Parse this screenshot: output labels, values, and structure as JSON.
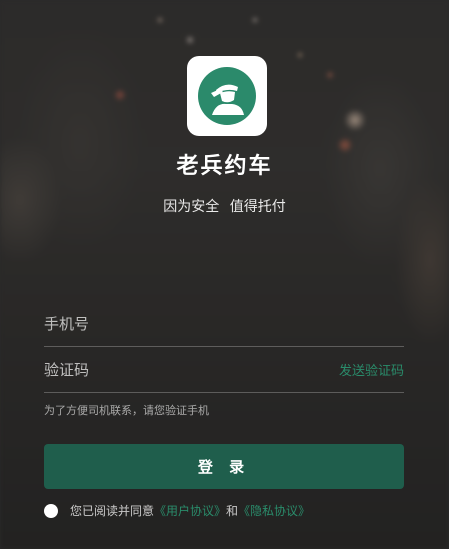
{
  "app": {
    "title": "老兵约车",
    "slogan": "因为安全 值得托付",
    "logo_icon": "soldier-salute-icon"
  },
  "form": {
    "phone_placeholder": "手机号",
    "code_placeholder": "验证码",
    "send_code_label": "发送验证码",
    "hint": "为了方便司机联系，请您验证手机",
    "login_label": "登 录"
  },
  "agreement": {
    "prefix": "您已阅读并同意",
    "user_agreement": "《用户协议》",
    "conjunction": "和",
    "privacy_agreement": "《隐私协议》"
  },
  "colors": {
    "accent": "#2a8c6b",
    "button": "#1f5e4c"
  }
}
